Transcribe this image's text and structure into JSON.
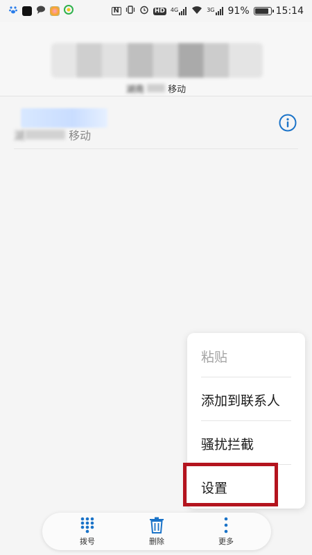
{
  "status_bar": {
    "app_icons": [
      "paw-icon",
      "tiktok-icon",
      "chat-icon",
      "flower-icon",
      "browser-icon"
    ],
    "system_icons": [
      "nfc-icon",
      "vibrate-icon",
      "alarm-icon",
      "hd-icon",
      "signal-4g-icon",
      "wifi-icon",
      "signal-3g-icon"
    ],
    "signal_4g": "4G",
    "signal_3g": "3G",
    "hd": "HD",
    "nfc": "N",
    "battery_percent": "91%",
    "battery_level": 0.91,
    "time": "15:14"
  },
  "caller": {
    "location": "湖南",
    "carrier": "移动"
  },
  "call_log": {
    "location": "湖",
    "carrier": "移动"
  },
  "menu": {
    "items": [
      {
        "label": "粘贴",
        "enabled": false
      },
      {
        "label": "添加到联系人",
        "enabled": true
      },
      {
        "label": "骚扰拦截",
        "enabled": true
      },
      {
        "label": "设置",
        "enabled": true
      }
    ],
    "highlight_color": "#b4141e"
  },
  "bottom_bar": {
    "dial_label": "拨号",
    "delete_label": "删除",
    "more_label": "更多"
  },
  "accent_color": "#1a73c8"
}
